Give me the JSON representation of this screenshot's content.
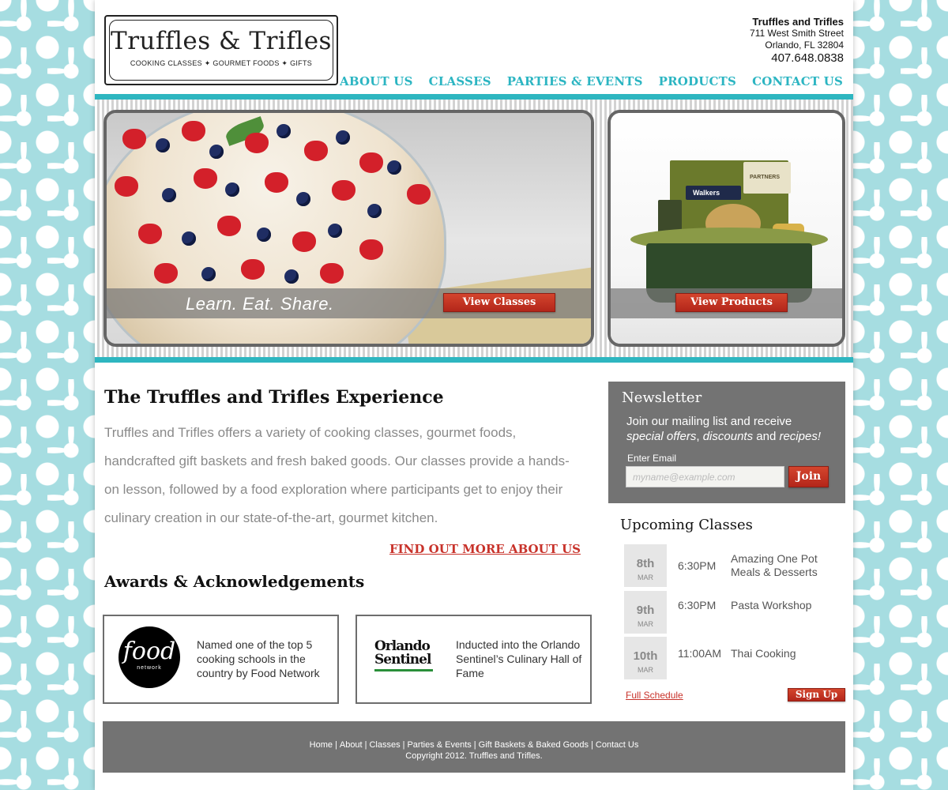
{
  "logo": {
    "title": "Truffles & Trifles",
    "subtitle": "COOKING CLASSES ✦ GOURMET FOODS ✦ GIFTS"
  },
  "contact": {
    "name": "Truffles and Trifles",
    "street": "711 West Smith Street",
    "city": "Orlando, FL 32804",
    "phone": "407.648.0838"
  },
  "nav": {
    "items": [
      "ABOUT US",
      "CLASSES",
      "PARTIES & EVENTS",
      "PRODUCTS",
      "CONTACT US"
    ]
  },
  "hero": {
    "tagline": "Learn. Eat. Share.",
    "classes_button": "View Classes",
    "products_button": "View Products",
    "basket_brand_1": "Walkers",
    "basket_brand_2": "PARTNERS"
  },
  "main": {
    "title": "The Truffles and Trifles Experience",
    "intro": "Truffles and Trifles offers a variety of cooking classes, gourmet foods, handcrafted gift baskets and fresh baked goods. Our classes provide a hands-on lesson, followed by a food exploration where participants get to enjoy their culinary creation in our state-of-the-art, gourmet kitchen.",
    "find_out_link": "FIND OUT MORE ABOUT US",
    "awards_title": "Awards & Acknowledgements"
  },
  "awards": [
    {
      "logo_main": "food",
      "logo_sub": "network",
      "text": "Named one of the top 5 cooking schools in the country by Food Network"
    },
    {
      "logo_main": "Orlando Sentinel",
      "text": "Inducted into the Orlando Sentinel’s Culinary Hall of Fame"
    }
  ],
  "newsletter": {
    "title": "Newsletter",
    "line1": "Join our mailing list and receive",
    "offers": "special offers",
    "comma1": ", ",
    "discounts": "discounts",
    "and": " and ",
    "recipes": "recipes!",
    "label": "Enter Email",
    "placeholder": "myname@example.com",
    "button": "Join"
  },
  "upcoming": {
    "title": "Upcoming Classes",
    "classes": [
      {
        "day": "8th",
        "month": "MAR",
        "time": "6:30PM",
        "name": "Amazing One Pot Meals & Desserts"
      },
      {
        "day": "9th",
        "month": "MAR",
        "time": "6:30PM",
        "name": "Pasta Workshop"
      },
      {
        "day": "10th",
        "month": "MAR",
        "time": "11:00AM",
        "name": "Thai Cooking"
      }
    ],
    "full_schedule": "Full Schedule",
    "signup": "Sign Up"
  },
  "footer": {
    "links": [
      "Home",
      "About",
      "Classes",
      "Parties & Events",
      "Gift Baskets & Baked Goods",
      "Contact Us"
    ],
    "copyright": "Copyright 2012. Truffles and Trifles."
  },
  "colors": {
    "accent_teal": "#2eb6c0",
    "button_red": "#b3261a",
    "panel_gray": "#737373",
    "background_damask": "#a6dde1"
  }
}
